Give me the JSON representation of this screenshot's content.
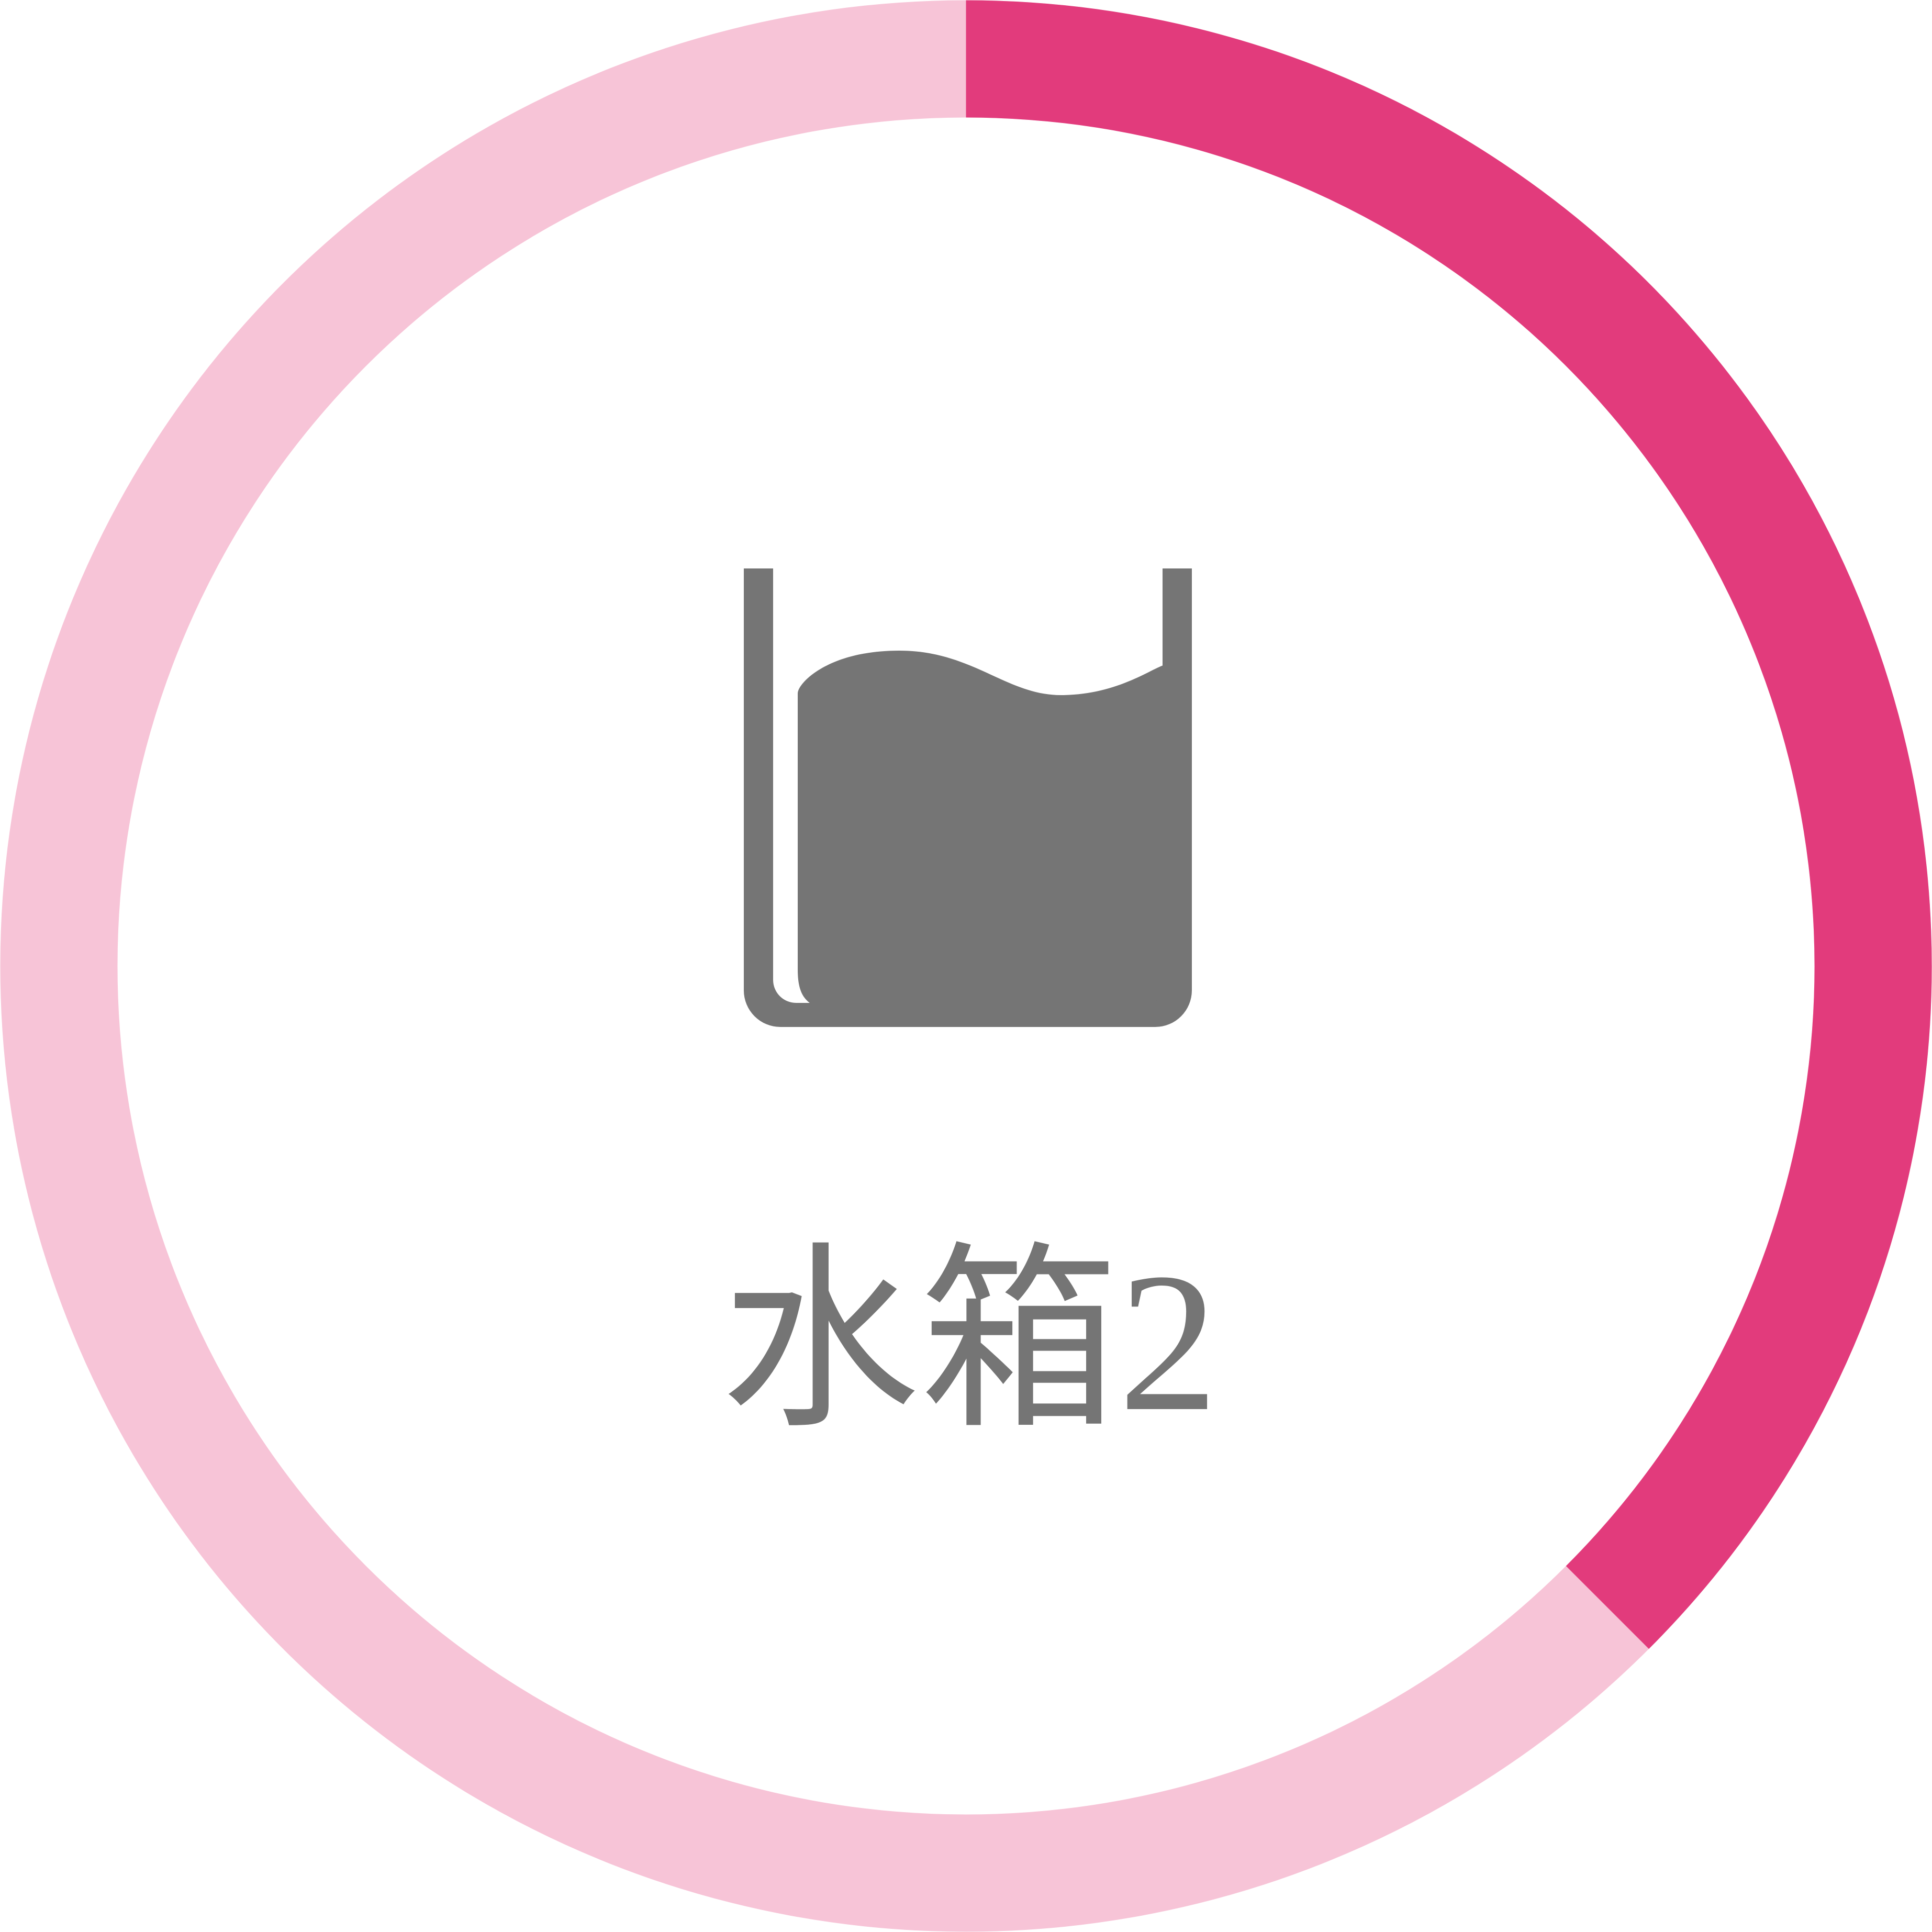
{
  "gauge": {
    "label": "水箱2",
    "progress_fraction": 0.375,
    "colors": {
      "track": "#f7c4d7",
      "progress": "#e23b7c",
      "icon": "#757575",
      "text": "#757575",
      "background": "#ffffff"
    },
    "icon": "water-tank-icon"
  }
}
